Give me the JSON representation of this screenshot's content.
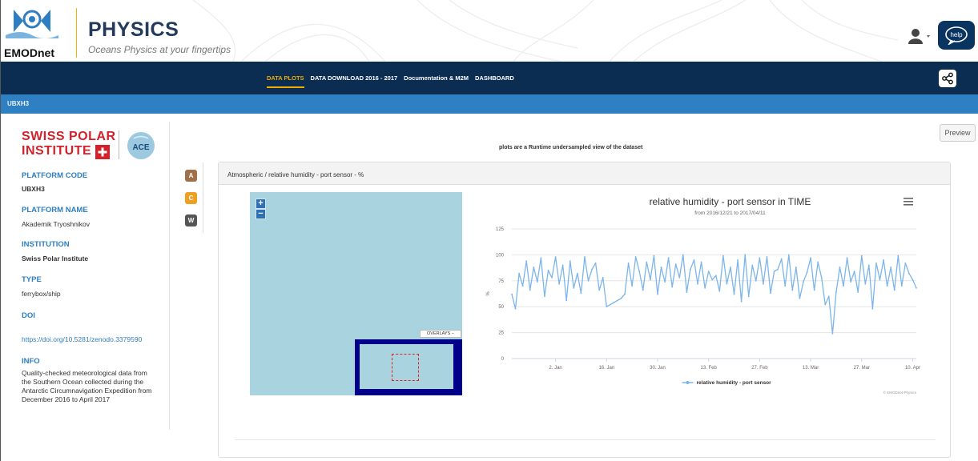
{
  "header": {
    "logo_text": "EMODnet",
    "title": "PHYSICS",
    "subtitle": "Oceans Physics at your fingertips",
    "help_label": "help"
  },
  "nav": {
    "items": [
      {
        "label": "DATA PLOTS",
        "active": true
      },
      {
        "label": "DATA DOWNLOAD 2016 - 2017",
        "active": false
      },
      {
        "label": "Documentation & M2M",
        "active": false
      },
      {
        "label": "DASHBOARD",
        "active": false
      }
    ]
  },
  "platform_bar": {
    "code": "UBXH3"
  },
  "sidebar": {
    "logo_line1": "SWISS POLAR",
    "logo_line2": "INSTITUTE",
    "logo_badge": "ACE",
    "fields": [
      {
        "label": "PLATFORM CODE",
        "value": "UBXH3"
      },
      {
        "label": "PLATFORM NAME",
        "value": "Akademik Tryoshnikov"
      },
      {
        "label": "INSTITUTION",
        "value": "Swiss Polar Institute"
      },
      {
        "label": "TYPE",
        "value": "ferrybox/ship"
      },
      {
        "label": "DOI",
        "value": "https://doi.org/10.5281/zenodo.3379590"
      },
      {
        "label": "INFO",
        "value": "Quality-checked meteorological data from the Southern Ocean collected during the Antarctic Circumnavigation Expedition from December 2016 to April 2017"
      }
    ]
  },
  "main": {
    "preview_label": "Preview",
    "runtime_note": "plots are a Runtime undersampled view of the dataset",
    "tabs": [
      {
        "label": "A",
        "color": "#a0704a"
      },
      {
        "label": "C",
        "color": "#f0a020"
      },
      {
        "label": "W",
        "color": "#555555"
      }
    ],
    "panel_title": "Atmospheric / relative humidity - port sensor - %",
    "map": {
      "zoom_in": "+",
      "zoom_out": "−",
      "overlays_label": "OVERLAYS −"
    }
  },
  "chart_data": {
    "type": "line",
    "title": "relative humidity - port sensor in TIME",
    "subtitle": "from 2016/12/21 to 2017/04/11",
    "ylabel": "%",
    "xlabel": "",
    "ylim": [
      0,
      125
    ],
    "yticks": [
      0,
      25,
      50,
      75,
      100,
      125
    ],
    "xlim": [
      "2016-12-21",
      "2017-04-11"
    ],
    "xticks": [
      "2. Jan",
      "16. Jan",
      "30. Jan",
      "13. Feb",
      "27. Feb",
      "13. Mar",
      "27. Mar",
      "10. Apr"
    ],
    "xtick_dates": [
      "2017-01-02",
      "2017-01-16",
      "2017-01-30",
      "2017-02-13",
      "2017-02-27",
      "2017-03-13",
      "2017-03-27",
      "2017-04-10"
    ],
    "grid": true,
    "legend": "bottom-center",
    "credit": "© EMODnet-Physics",
    "color": "#7cb5ec",
    "series": [
      {
        "name": "relative humidity - port sensor",
        "x": [
          "2016-12-21",
          "2016-12-22",
          "2016-12-23",
          "2016-12-24",
          "2016-12-25",
          "2016-12-26",
          "2016-12-27",
          "2016-12-28",
          "2016-12-29",
          "2016-12-30",
          "2016-12-31",
          "2017-01-01",
          "2017-01-02",
          "2017-01-03",
          "2017-01-04",
          "2017-01-05",
          "2017-01-06",
          "2017-01-07",
          "2017-01-08",
          "2017-01-09",
          "2017-01-10",
          "2017-01-11",
          "2017-01-12",
          "2017-01-13",
          "2017-01-14",
          "2017-01-15",
          "2017-01-16",
          "2017-01-17",
          "2017-01-18",
          "2017-01-19",
          "2017-01-20",
          "2017-01-21",
          "2017-01-22",
          "2017-01-23",
          "2017-01-24",
          "2017-01-25",
          "2017-01-26",
          "2017-01-27",
          "2017-01-28",
          "2017-01-29",
          "2017-01-30",
          "2017-01-31",
          "2017-02-01",
          "2017-02-02",
          "2017-02-03",
          "2017-02-04",
          "2017-02-05",
          "2017-02-06",
          "2017-02-07",
          "2017-02-08",
          "2017-02-09",
          "2017-02-10",
          "2017-02-11",
          "2017-02-12",
          "2017-02-13",
          "2017-02-14",
          "2017-02-15",
          "2017-02-16",
          "2017-02-17",
          "2017-02-18",
          "2017-02-19",
          "2017-02-20",
          "2017-02-21",
          "2017-02-22",
          "2017-02-23",
          "2017-02-24",
          "2017-02-25",
          "2017-02-26",
          "2017-02-27",
          "2017-02-28",
          "2017-03-01",
          "2017-03-02",
          "2017-03-03",
          "2017-03-04",
          "2017-03-05",
          "2017-03-06",
          "2017-03-07",
          "2017-03-08",
          "2017-03-09",
          "2017-03-10",
          "2017-03-11",
          "2017-03-12",
          "2017-03-13",
          "2017-03-14",
          "2017-03-15",
          "2017-03-16",
          "2017-03-17",
          "2017-03-18",
          "2017-03-19",
          "2017-03-20",
          "2017-03-21",
          "2017-03-22",
          "2017-03-23",
          "2017-03-24",
          "2017-03-25",
          "2017-03-26",
          "2017-03-27",
          "2017-03-28",
          "2017-03-29",
          "2017-03-30",
          "2017-03-31",
          "2017-04-01",
          "2017-04-02",
          "2017-04-03",
          "2017-04-04",
          "2017-04-05",
          "2017-04-06",
          "2017-04-07",
          "2017-04-08",
          "2017-04-09",
          "2017-04-10",
          "2017-04-11"
        ],
        "y": [
          62,
          48,
          82,
          70,
          94,
          66,
          88,
          74,
          97,
          60,
          85,
          78,
          98,
          72,
          90,
          56,
          94,
          68,
          82,
          63,
          98,
          75,
          86,
          92,
          66,
          78,
          50,
          52,
          54,
          56,
          58,
          62,
          92,
          70,
          98,
          84,
          66,
          93,
          76,
          99,
          62,
          88,
          74,
          97,
          69,
          91,
          78,
          100,
          64,
          86,
          95,
          72,
          93,
          68,
          84,
          76,
          80,
          65,
          99,
          72,
          88,
          62,
          95,
          55,
          100,
          60,
          90,
          75,
          97,
          72,
          98,
          63,
          84,
          86,
          96,
          70,
          100,
          66,
          88,
          58,
          74,
          83,
          97,
          66,
          93,
          78,
          52,
          60,
          24,
          64,
          88,
          70,
          97,
          74,
          84,
          64,
          99,
          72,
          90,
          48,
          92,
          76,
          95,
          70,
          88,
          66,
          99,
          70,
          92,
          82,
          76,
          68
        ]
      }
    ]
  }
}
